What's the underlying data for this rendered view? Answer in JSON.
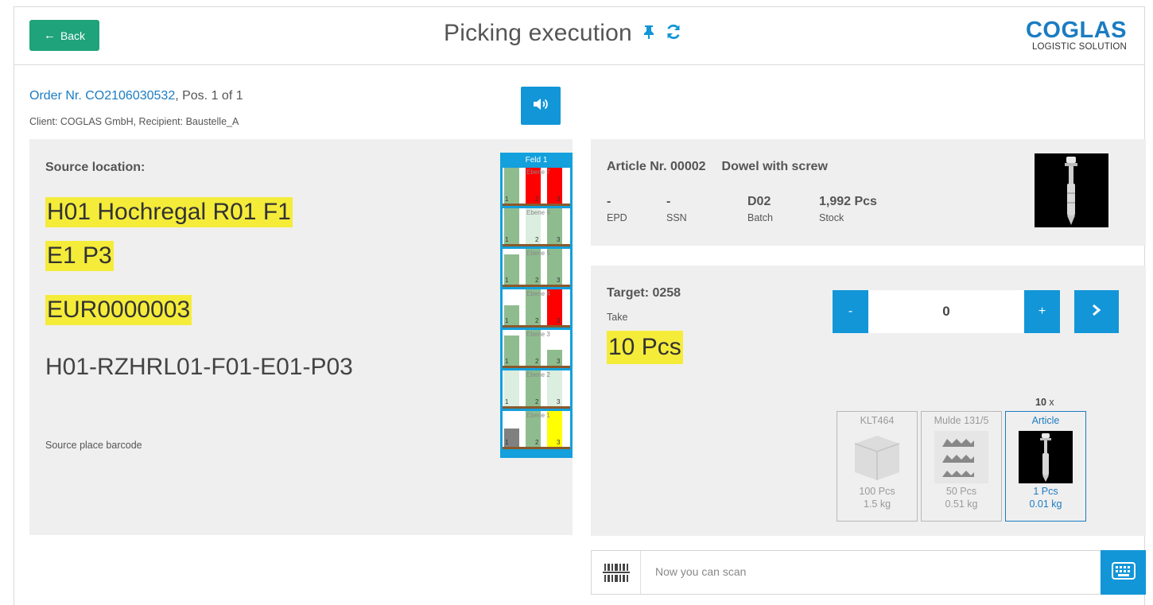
{
  "header": {
    "back_label": "Back",
    "title": "Picking execution",
    "pin_icon": "pin-icon",
    "refresh_icon": "refresh-icon",
    "logo_main": "COGLAS",
    "logo_sub": "LOGISTIC SOLUTION"
  },
  "order": {
    "link_text": "Order Nr. CO2106030532",
    "position_text": ", Pos. 1 of 1",
    "client_text": "Client: COGLAS GmbH, Recipient: Baustelle_A"
  },
  "source": {
    "label": "Source location:",
    "location_line1": "H01 Hochregal R01 F1",
    "location_line2": "E1 P3",
    "pallet": "EUR0000003",
    "barcode": "H01-RZHRL01-F01-E01-P03",
    "barcode_label": "Source place barcode",
    "rack": {
      "title": "Feld 1",
      "shelves": [
        {
          "label": "Ebene 7",
          "fills": [
            "green",
            "red",
            "red"
          ],
          "levels": [
            1.0,
            1.0,
            1.0
          ]
        },
        {
          "label": "Ebene 6",
          "fills": [
            "green",
            "light",
            "green"
          ],
          "levels": [
            1.0,
            1.0,
            1.0
          ]
        },
        {
          "label": "Ebene 5",
          "fills": [
            "green",
            "green",
            "green"
          ],
          "levels": [
            0.85,
            1.0,
            1.0
          ]
        },
        {
          "label": "Ebene 4",
          "fills": [
            "green",
            "green",
            "red"
          ],
          "levels": [
            0.55,
            1.0,
            1.0
          ]
        },
        {
          "label": "Ebene 3",
          "fills": [
            "green",
            "green",
            "green"
          ],
          "levels": [
            0.85,
            1.0,
            0.45
          ]
        },
        {
          "label": "Ebene 2",
          "fills": [
            "light",
            "green",
            "light"
          ],
          "levels": [
            1.0,
            1.0,
            1.0
          ]
        },
        {
          "label": "Ebene 1",
          "fills": [
            "gray",
            "green",
            "yellow"
          ],
          "levels": [
            0.5,
            1.0,
            1.0
          ]
        }
      ],
      "slot_numbers": [
        "1",
        "2",
        "3"
      ]
    }
  },
  "article": {
    "nr_label": "Article Nr. 00002",
    "name": "Dowel with screw",
    "meta": [
      {
        "value": "-",
        "key": "EPD"
      },
      {
        "value": "-",
        "key": "SSN"
      },
      {
        "value": "D02",
        "key": "Batch"
      },
      {
        "value": "1,992 Pcs",
        "key": "Stock"
      }
    ]
  },
  "target": {
    "label": "Target: 0258",
    "take_label": "Take",
    "take_qty": "10 Pcs",
    "stepper_value": "0",
    "minus_label": "-",
    "plus_label": "+",
    "multiplier": "10",
    "multiplier_suffix": " x",
    "units": [
      {
        "name": "KLT464",
        "pcs": "100 Pcs",
        "kg": "1.5 kg",
        "active": false
      },
      {
        "name": "Mulde 131/5",
        "pcs": "50 Pcs",
        "kg": "0.51 kg",
        "active": false
      },
      {
        "name": "Article",
        "pcs": "1 Pcs",
        "kg": "0.01 kg",
        "active": true
      }
    ]
  },
  "scan": {
    "placeholder": "Now you can scan"
  },
  "colors": {
    "primary": "#1296d8",
    "back_green": "#1fa37a",
    "highlight": "#f5ec3a",
    "rack_green": "#8fbc8f",
    "rack_red": "#ff0000",
    "rack_yellow": "#ffff00",
    "rack_gray": "#808080",
    "rack_light": "#dbeee0"
  }
}
